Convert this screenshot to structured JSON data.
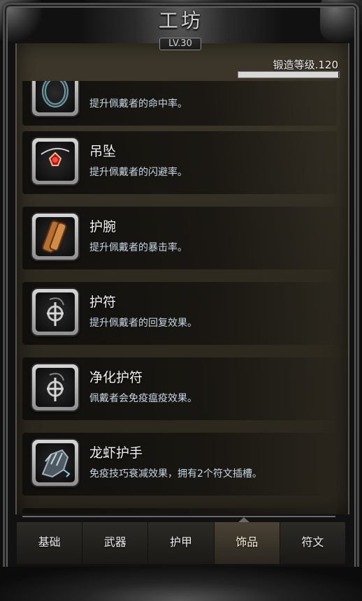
{
  "header": {
    "title": "工坊",
    "level": "LV.30",
    "forge_level_label": "锻造等级.120",
    "forge_progress": 0.99
  },
  "items": [
    {
      "name": "",
      "desc": "提升佩戴者的命中率。",
      "icon": "ring-icon"
    },
    {
      "name": "吊坠",
      "desc": "提升佩戴者的闪避率。",
      "icon": "pendant-icon"
    },
    {
      "name": "护腕",
      "desc": "提升佩戴者的暴击率。",
      "icon": "bracer-icon"
    },
    {
      "name": "护符",
      "desc": "提升佩戴者的回复效果。",
      "icon": "amulet-icon"
    },
    {
      "name": "净化护符",
      "desc": "佩戴者会免疫瘟疫效果。",
      "icon": "purify-amulet-icon"
    },
    {
      "name": "龙虾护手",
      "desc": "免疫技巧衰减效果，拥有2个符文插槽。",
      "icon": "gauntlet-icon"
    }
  ],
  "tabs": [
    {
      "label": "基础",
      "active": false
    },
    {
      "label": "武器",
      "active": false
    },
    {
      "label": "护甲",
      "active": false
    },
    {
      "label": "饰品",
      "active": true
    },
    {
      "label": "符文",
      "active": false
    }
  ]
}
